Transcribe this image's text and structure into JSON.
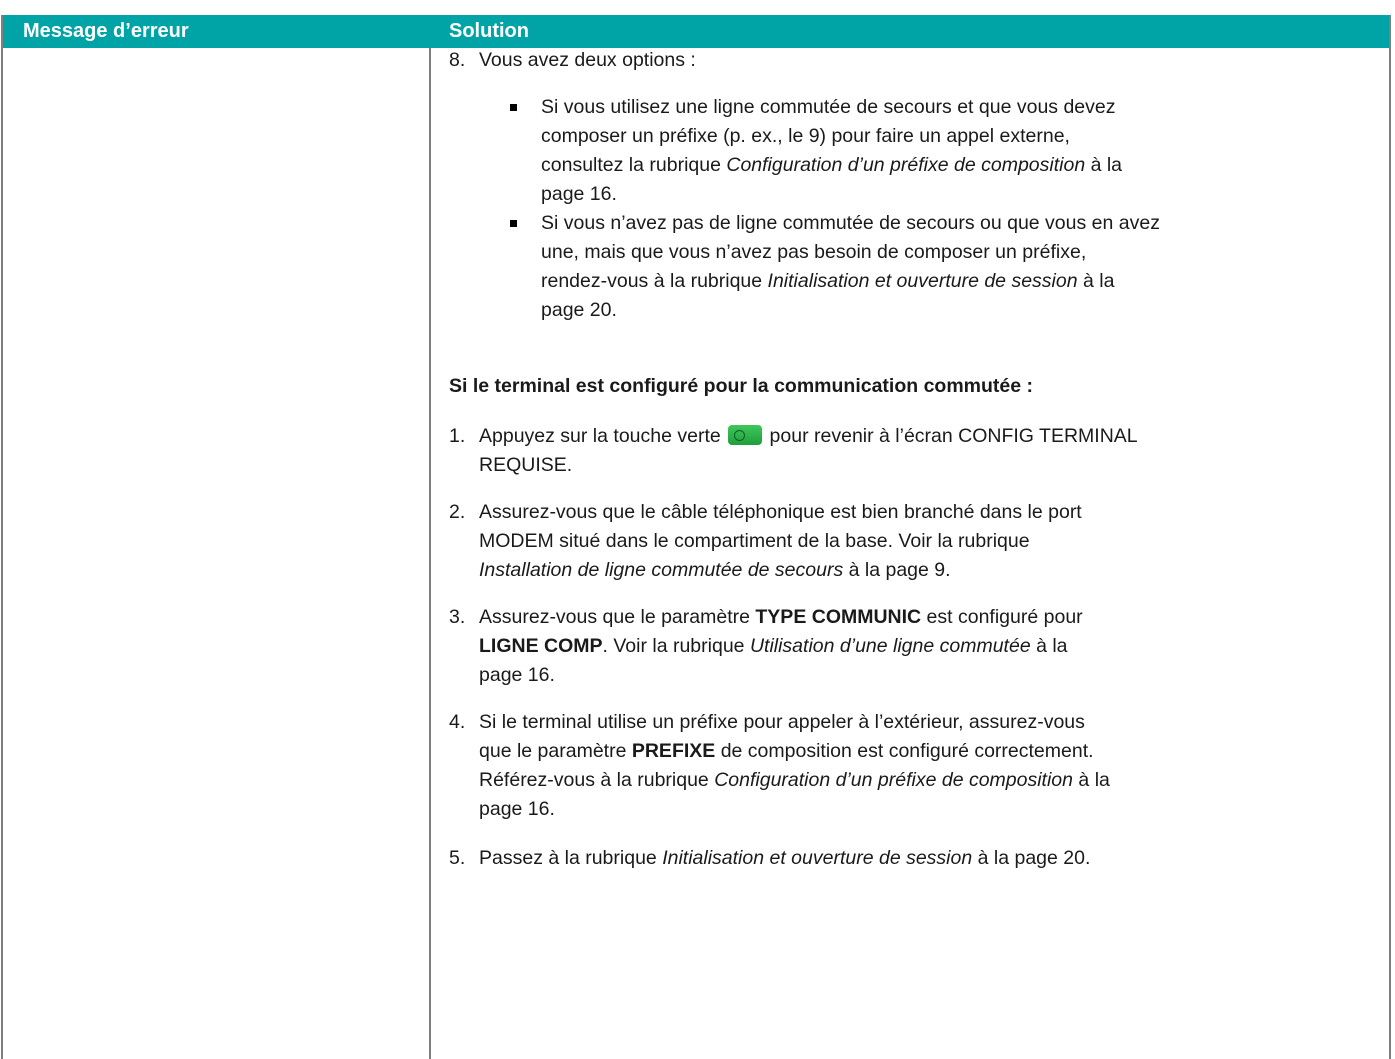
{
  "header": {
    "col1": "Message d’erreur",
    "col2": "Solution"
  },
  "step8": {
    "num": "8.",
    "text": "Vous avez deux options :",
    "bullets": [
      {
        "l1": "Si vous utilisez une ligne commutée de secours et que vous devez",
        "l2": "composer un préfixe (p. ex., le 9) pour faire un appel externe,",
        "l3a": "consultez la rubrique ",
        "l3i": "Configuration d’un préfixe de composition",
        "l3b": " à la",
        "l4": "page 16."
      },
      {
        "l1": "Si vous n’avez pas de ligne commutée de secours ou que vous en avez",
        "l2": "une, mais que vous n’avez pas besoin de composer un préfixe,",
        "l3a": "rendez-vous à la rubrique ",
        "l3i": "Initialisation et ouverture de session",
        "l3b": " à la",
        "l4": "page 20."
      }
    ]
  },
  "section_title": "Si le terminal est configuré pour la communication commutée :",
  "steps": {
    "s1": {
      "num": "1.",
      "a": "Appuyez sur la touche verte ",
      "b": " pour revenir à l’écran CONFIG TERMINAL",
      "c": "REQUISE."
    },
    "s2": {
      "num": "2.",
      "l1": "Assurez-vous que le câble téléphonique est bien branché dans le port",
      "l2": "MODEM situé dans le compartiment de la base. Voir la rubrique",
      "l3i": "Installation de ligne commutée de secours",
      "l3b": " à la page 9."
    },
    "s3": {
      "num": "3.",
      "l1a": "Assurez-vous que le paramètre ",
      "l1b": "TYPE COMMUNIC",
      "l1c": " est configuré pour",
      "l2a": "LIGNE COMP",
      "l2b": ". Voir la rubrique ",
      "l2i": "Utilisation d’une ligne commutée",
      "l2c": " à la",
      "l3": "page 16."
    },
    "s4": {
      "num": "4.",
      "l1": "Si le terminal utilise un préfixe pour appeler à l’extérieur, assurez-vous",
      "l2a": "que le paramètre ",
      "l2b": "PREFIXE",
      "l2c": " de composition est configuré correctement.",
      "l3a": "Référez-vous à la rubrique ",
      "l3i": "Configuration d’un préfixe de composition",
      "l3b": " à la",
      "l4": "page 16."
    },
    "s5": {
      "num": "5.",
      "a": "Passez à la rubrique ",
      "i": "Initialisation et ouverture de session",
      "b": " à la page 20."
    }
  },
  "icons": {
    "green_key": "green-key-icon",
    "bullet": "square-bullet-icon"
  },
  "colors": {
    "header_bg": "#00a3a6",
    "key_green": "#2cb44b"
  }
}
